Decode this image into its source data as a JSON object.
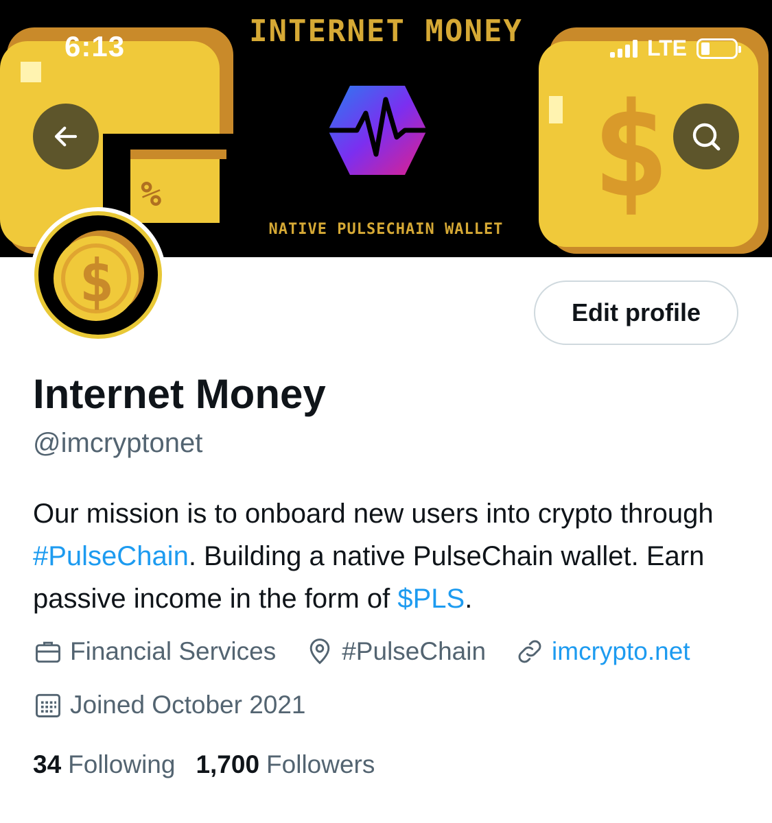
{
  "status_bar": {
    "time": "6:13",
    "network": "LTE"
  },
  "banner": {
    "title": "INTERNET MONEY",
    "subtitle": "NATIVE PULSECHAIN WALLET"
  },
  "nav": {
    "back_icon": "back-arrow-icon",
    "search_icon": "search-icon"
  },
  "profile": {
    "edit_label": "Edit profile",
    "name": "Internet Money",
    "handle": "@imcryptonet",
    "bio": {
      "part1": "Our mission is to onboard new users into crypto through ",
      "hashtag": "#PulseChain",
      "part2": ". Building a native PulseChain wallet. Earn passive income in the form of ",
      "cashtag": "$PLS",
      "part3": "."
    },
    "category": "Financial Services",
    "location": "#PulseChain",
    "website": "imcrypto.net",
    "joined": "Joined October 2021",
    "following_count": "34",
    "following_label": "Following",
    "followers_count": "1,700",
    "followers_label": "Followers"
  },
  "colors": {
    "link": "#1d9bf0",
    "secondary_text": "#536471",
    "coin_gold": "#e8c836"
  }
}
